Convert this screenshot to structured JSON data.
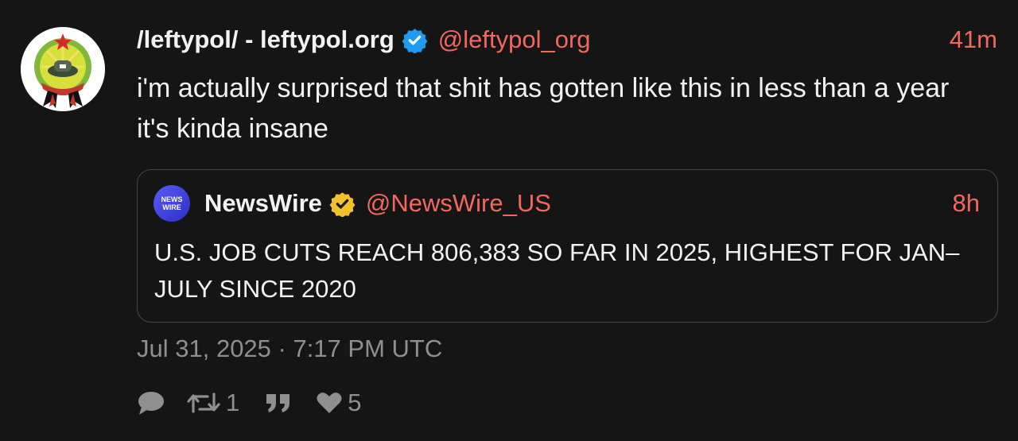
{
  "post": {
    "display_name": "/leftypol/ - leftypol.org",
    "handle": "@leftypol_org",
    "time": "41m",
    "text": "i'm actually surprised that shit has gotten like this in less than a year it's kinda insane",
    "timestamp": "Jul 31, 2025 · 7:17 PM UTC",
    "avatar_icon": "emblem-avatar-icon",
    "verified_icon": "blue-verified-badge-icon"
  },
  "quote": {
    "display_name": "NewsWire",
    "handle": "@NewsWire_US",
    "time": "8h",
    "text": "U.S. JOB CUTS REACH 806,383 SO FAR IN 2025, HIGHEST FOR JAN–JULY SINCE 2020",
    "avatar_line1": "NEWS",
    "avatar_line2": "WIRE",
    "verified_icon": "gold-verified-badge-icon"
  },
  "actions": {
    "reply_icon": "speech-bubble-icon",
    "repost_icon": "repost-arrows-icon",
    "repost_count": "1",
    "quote_icon": "quotation-marks-icon",
    "like_icon": "heart-icon",
    "like_count": "5"
  },
  "colors": {
    "background": "#151515",
    "text": "#f2f2f2",
    "accent_handle": "#f3685e",
    "muted": "#8f8f8f",
    "verified_blue": "#1d9bf0",
    "verified_gold": "#f4c12e",
    "quote_border": "#464646"
  }
}
